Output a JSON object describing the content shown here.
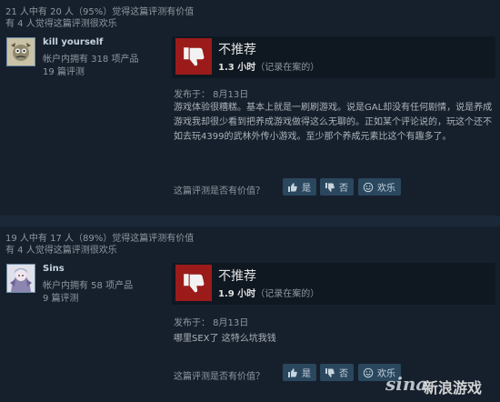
{
  "reviews": [
    {
      "helpful_summary": "21 人中有 20 人（95%）觉得这篇评测有价值",
      "funny_summary": "有 4 人觉得这篇评测很欢乐",
      "author": {
        "name": "kill yourself",
        "products_owned": "帐户内拥有 318 项产品",
        "review_count": "19 篇评测"
      },
      "verdict": "不推荐",
      "hours_value": "1.3 小时",
      "hours_suffix": "（记录在案的）",
      "posted": "发布于：  8月13日",
      "content": "游戏体验很糟糕。基本上就是一刷刷游戏。说是GAL却没有任何剧情，说是养成游戏我却很少看到把养成游戏做得这么无聊的。正如某个评论说的，玩这个还不如去玩4399的武林外传小游戏。至少那个养成元素比这个有趣多了。",
      "question": "这篇评测是否有价值？",
      "buttons": {
        "yes": "是",
        "no": "否",
        "funny": "欢乐"
      }
    },
    {
      "helpful_summary": "19 人中有 17 人（89%）觉得这篇评测有价值",
      "funny_summary": "有 4 人觉得这篇评测很欢乐",
      "author": {
        "name": "Sins",
        "products_owned": "帐户内拥有 58 项产品",
        "review_count": "9 篇评测"
      },
      "verdict": "不推荐",
      "hours_value": "1.9 小时",
      "hours_suffix": "（记录在案的）",
      "posted": "发布于：  8月13日",
      "content": "哪里SEX了 这特么坑我钱",
      "question": "这篇评测是否有价值？",
      "buttons": {
        "yes": "是",
        "no": "否",
        "funny": "欢乐"
      }
    }
  ],
  "watermark": {
    "logo": "sina",
    "text": "新浪游戏"
  },
  "colors": {
    "page_bg": "#1b2838",
    "panel_bg": "#16202d",
    "thumb_down_red": "#9b1b1b",
    "button_bg": "#2a475e"
  },
  "icons": {
    "thumb_down": "thumb-down-icon",
    "thumb_up": "thumb-up-icon",
    "smile": "smile-icon"
  }
}
